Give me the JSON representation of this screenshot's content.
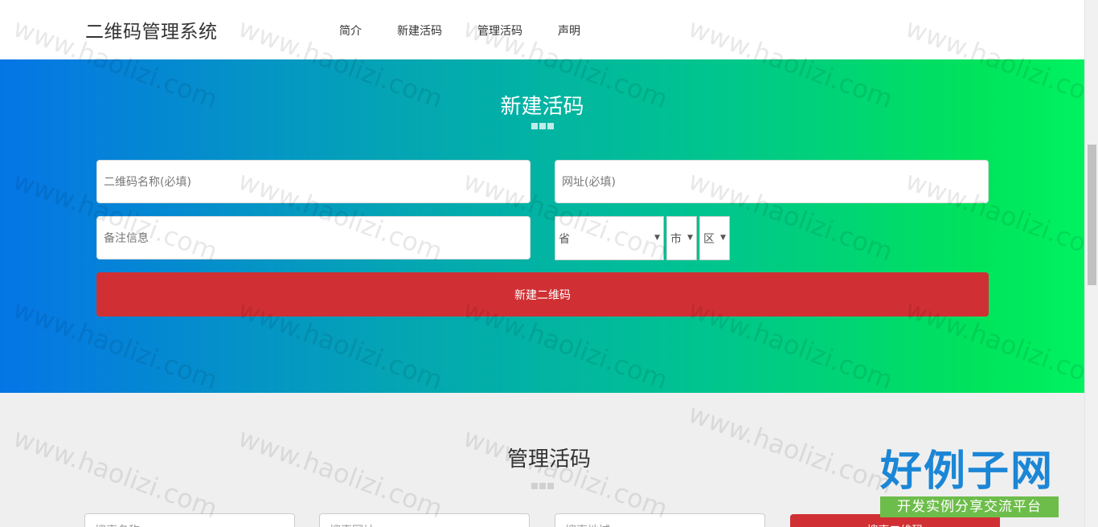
{
  "navbar": {
    "brand": "二维码管理系统",
    "links": [
      "简介",
      "新建活码",
      "管理活码",
      "声明"
    ]
  },
  "create": {
    "title": "新建活码",
    "name_placeholder": "二维码名称(必填)",
    "url_placeholder": "网址(必填)",
    "note_placeholder": "备注信息",
    "province": "省",
    "city": "市",
    "district": "区",
    "submit_label": "新建二维码"
  },
  "manage": {
    "title": "管理活码",
    "search_name_placeholder": "搜索名称",
    "search_url_placeholder": "搜索网址",
    "search_addr_placeholder": "搜索地域",
    "search_button": "搜索二维码"
  },
  "logo": {
    "main": "好例子网",
    "sub": "开发实例分享交流平台"
  },
  "watermark": "www.haolizi.com",
  "colors": {
    "hero_start": "#0575e6",
    "hero_end": "#00f260",
    "button": "#d03034"
  }
}
